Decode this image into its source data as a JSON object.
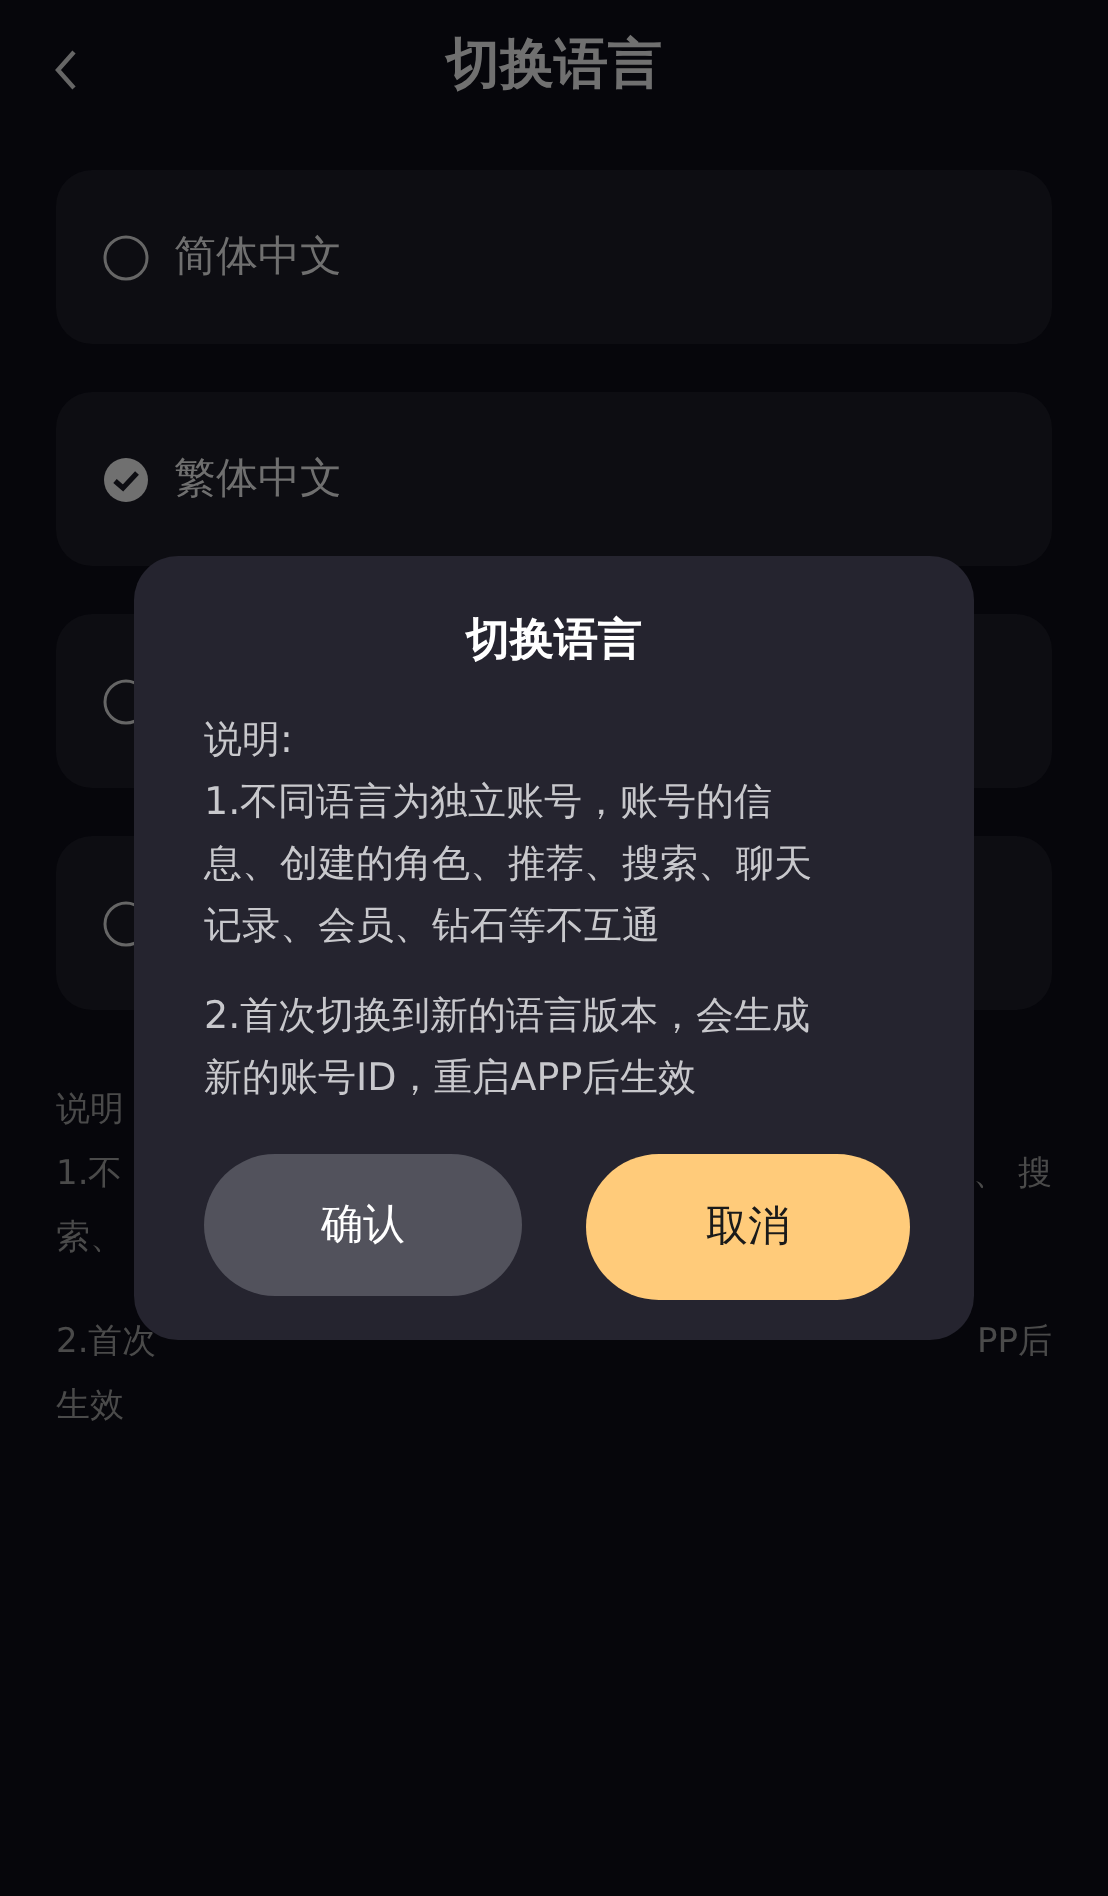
{
  "header": {
    "title": "切换语言"
  },
  "options": [
    {
      "label": "简体中文",
      "selected": false
    },
    {
      "label": "繁体中文",
      "selected": true
    },
    {
      "selected": false
    },
    {
      "selected": false
    }
  ],
  "notes": [
    [
      {
        "left": "说明"
      },
      {
        "left": "1.不",
        "right": "、 搜"
      },
      {
        "left": "索、"
      }
    ],
    [
      {
        "left": "2.首次",
        "right": "PP后"
      },
      {
        "left": "生效"
      }
    ]
  ],
  "dialog": {
    "title": "切换语言",
    "paragraphs": [
      "说明:\n1.不同语言为独立账号，账号的信息、创建的角色、推荐、搜索、聊天记录、会员、钻石等不互通",
      "2.首次切换到新的语言版本，会生成新的账号ID，重启APP后生效"
    ],
    "buttons": [
      {
        "label": "确认",
        "kind": "confirm"
      },
      {
        "label": "取消",
        "kind": "cancel"
      }
    ]
  }
}
